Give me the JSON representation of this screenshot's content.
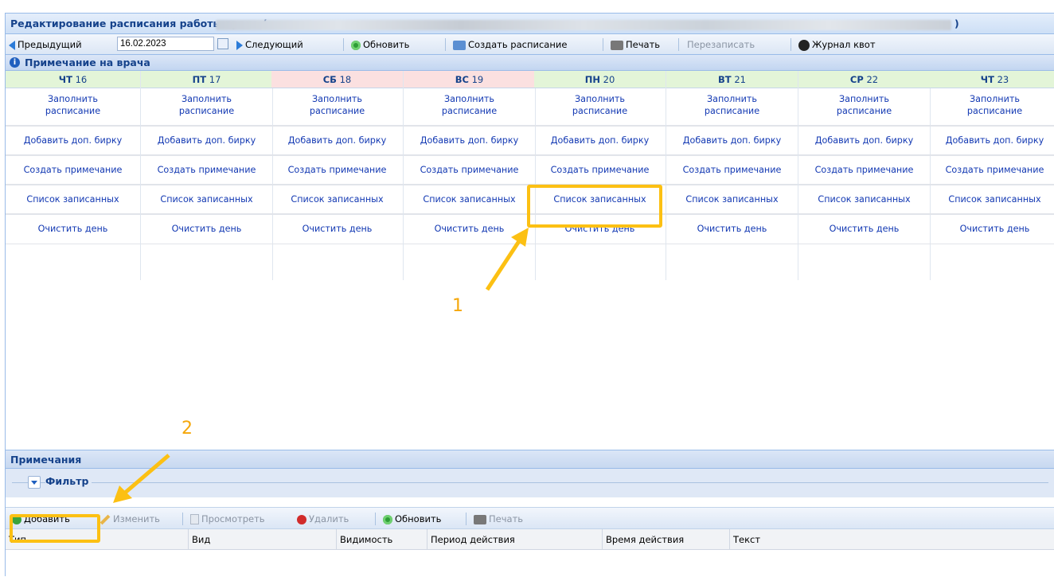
{
  "window": {
    "title": "Редактирование расписания работы врача (",
    "title_end": ")"
  },
  "toolbar": {
    "prev_label": "Предыдущий",
    "date_value": "16.02.2023",
    "next_label": "Следующий",
    "refresh_label": "Обновить",
    "create_schedule_label": "Создать расписание",
    "print_label": "Печать",
    "rewrite_label": "Перезаписать",
    "journal_label": "Журнал квот"
  },
  "note_bar": {
    "label": "Примечание на врача"
  },
  "days": [
    {
      "dow": "ЧТ",
      "num": "16",
      "weekend": false
    },
    {
      "dow": "ПТ",
      "num": "17",
      "weekend": false
    },
    {
      "dow": "СБ",
      "num": "18",
      "weekend": true
    },
    {
      "dow": "ВС",
      "num": "19",
      "weekend": true
    },
    {
      "dow": "ПН",
      "num": "20",
      "weekend": false
    },
    {
      "dow": "ВТ",
      "num": "21",
      "weekend": false
    },
    {
      "dow": "СР",
      "num": "22",
      "weekend": false
    },
    {
      "dow": "ЧТ",
      "num": "23",
      "weekend": false
    }
  ],
  "day_actions": {
    "fill_line1": "Заполнить",
    "fill_line2": "расписание",
    "add_tag": "Добавить доп. бирку",
    "create_note": "Создать примечание",
    "patients_list": "Список записанных",
    "clear_day": "Очистить день"
  },
  "annotations": {
    "step1": "1",
    "step2": "2"
  },
  "notes_panel": {
    "title": "Примечания",
    "filter_label": "Фильтр",
    "toolbar": {
      "add": "Добавить",
      "edit": "Изменить",
      "view": "Просмотреть",
      "delete": "Удалить",
      "refresh": "Обновить",
      "print": "Печать"
    },
    "columns": [
      "Тип",
      "Вид",
      "Видимость",
      "Период действия",
      "Время действия",
      "Текст"
    ]
  },
  "colors": {
    "accent": "#15428b",
    "link": "#1339b3",
    "highlight": "#fcc013",
    "workday_header": "#e3f5d8",
    "weekend_header": "#fbe0e0"
  }
}
